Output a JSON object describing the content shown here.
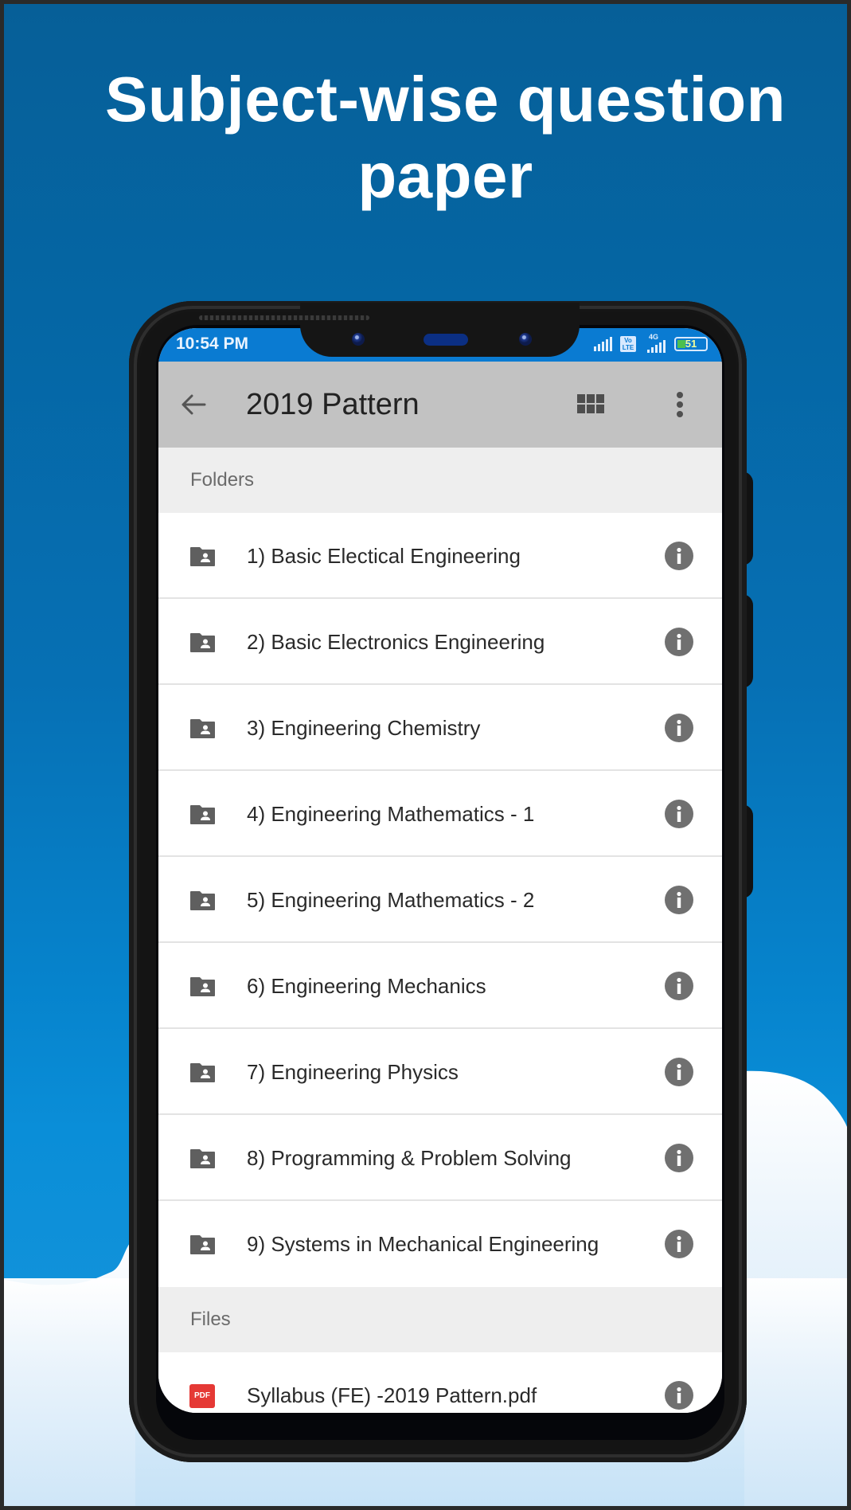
{
  "promo": {
    "headline_line1": "Subject-wise question",
    "headline_line2": "paper"
  },
  "status_bar": {
    "time": "10:54 PM",
    "network_type": "4G",
    "volte_label_top": "Vo",
    "volte_label_bottom": "LTE",
    "battery_level": "51"
  },
  "toolbar": {
    "title": "2019 Pattern",
    "back_icon": "arrow-back-icon",
    "view_toggle_icon": "grid-view-icon",
    "more_icon": "more-vert-icon"
  },
  "folders": {
    "header": "Folders",
    "items": [
      {
        "label": "1) Basic Electical Engineering",
        "icon": "shared-folder-icon",
        "action_icon": "info-icon"
      },
      {
        "label": "2) Basic Electronics Engineering",
        "icon": "shared-folder-icon",
        "action_icon": "info-icon"
      },
      {
        "label": "3) Engineering Chemistry",
        "icon": "shared-folder-icon",
        "action_icon": "info-icon"
      },
      {
        "label": "4) Engineering Mathematics - 1",
        "icon": "shared-folder-icon",
        "action_icon": "info-icon"
      },
      {
        "label": "5) Engineering Mathematics - 2",
        "icon": "shared-folder-icon",
        "action_icon": "info-icon"
      },
      {
        "label": "6) Engineering Mechanics",
        "icon": "shared-folder-icon",
        "action_icon": "info-icon"
      },
      {
        "label": "7) Engineering Physics",
        "icon": "shared-folder-icon",
        "action_icon": "info-icon"
      },
      {
        "label": "8) Programming & Problem Solving",
        "icon": "shared-folder-icon",
        "action_icon": "info-icon"
      },
      {
        "label": "9) Systems in Mechanical Engineering",
        "icon": "shared-folder-icon",
        "action_icon": "info-icon"
      }
    ]
  },
  "files": {
    "header": "Files",
    "items": [
      {
        "label": "Syllabus (FE) -2019 Pattern.pdf",
        "icon": "pdf-icon",
        "badge": "PDF",
        "action_icon": "info-icon"
      }
    ]
  },
  "colors": {
    "status_bar": "#0a7bd2",
    "toolbar": "#c2c2c2",
    "section_header_bg": "#eeeeee",
    "icon_gray": "#5f5f5f",
    "info_gray": "#707070",
    "pdf_red": "#e53935"
  }
}
